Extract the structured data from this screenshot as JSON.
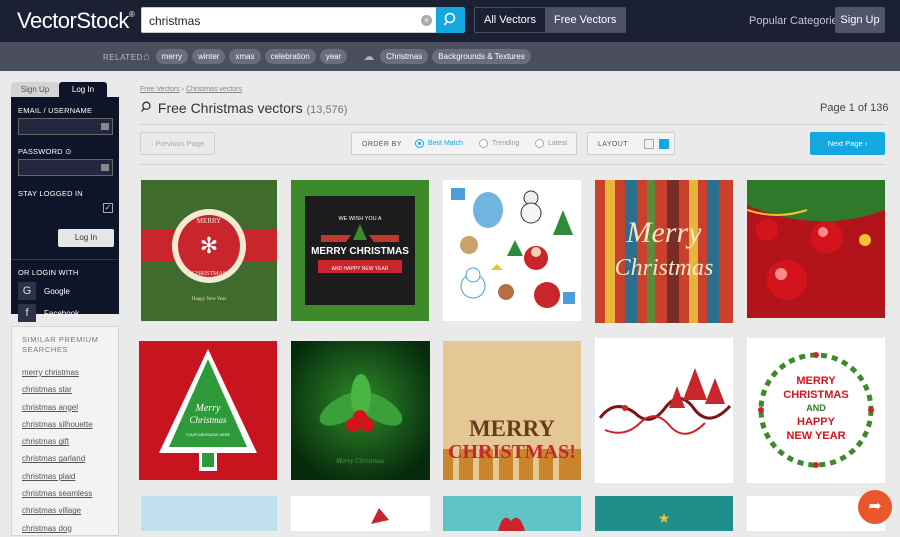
{
  "header": {
    "logo": "VectorStock",
    "logo_mark": "®",
    "search_value": "christmas",
    "scope_all": "All Vectors",
    "scope_free": "Free Vectors",
    "popular_categories": "Popular Categories",
    "sign_up": "Sign Up"
  },
  "related": {
    "label": "RELATED",
    "tags_group1": [
      "merry",
      "winter",
      "xmas",
      "celebration",
      "year"
    ],
    "tags_group2": [
      "Christmas",
      "Backgrounds & Textures"
    ]
  },
  "login": {
    "tab_signup": "Sign Up",
    "tab_login": "Log In",
    "email_label": "EMAIL / USERNAME",
    "password_label": "PASSWORD",
    "stay_logged_in": "STAY LOGGED IN",
    "login_button": "Log In",
    "or_login_with": "OR LOGIN WITH",
    "google": "Google",
    "facebook": "Facebook"
  },
  "similar": {
    "heading": "SIMILAR PREMIUM SEARCHES",
    "items": [
      "merry christmas",
      "christmas star",
      "christmas angel",
      "christmas silhouette",
      "christmas gift",
      "christmas garland",
      "christmas plaid",
      "christmas seamless",
      "christmas village",
      "christmas dog"
    ]
  },
  "main": {
    "breadcrumb_1": "Free Vectors",
    "breadcrumb_sep": "›",
    "breadcrumb_2": "Christmas vectors",
    "title": "Free Christmas vectors",
    "count": "(13,576)",
    "page_info": "Page 1 of 136",
    "prev_page": "Previous Page",
    "order_by": "ORDER BY",
    "order_options": [
      "Best Match",
      "Trending",
      "Latest"
    ],
    "layout": "LAYOUT",
    "next_page": "Next Page"
  },
  "tiles": {
    "t1": {
      "line1": "MERRY",
      "line2": "CHRISTMAS",
      "footer": "Happy New Year"
    },
    "t2": {
      "top": "WE WISH YOU A",
      "main": "MERRY CHRISTMAS",
      "sub": "AND HAPPY NEW YEAR"
    },
    "t4": {
      "line1": "Merry",
      "line2": "Christmas"
    },
    "t6": {
      "line1": "Merry",
      "line2": "Christmas",
      "sub": "YOUR MESSAGE HERE"
    },
    "t7": {
      "caption": "Merry Christmas"
    },
    "t8": {
      "line1": "MERRY",
      "line2": "CHRISTMAS!"
    },
    "t10": {
      "l1": "MERRY",
      "l2": "CHRISTMAS",
      "l3": "AND",
      "l4": "HAPPY",
      "l5": "NEW YEAR"
    }
  }
}
